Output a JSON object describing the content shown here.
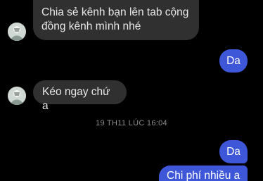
{
  "messages": [
    {
      "id": "m1",
      "direction": "incoming",
      "text_line1": "Chia sẻ kênh bạn lên tab cộng",
      "text_line2": "đồng kênh mình nhé"
    },
    {
      "id": "m2",
      "direction": "outgoing",
      "text": "Da"
    },
    {
      "id": "m3",
      "direction": "incoming",
      "text": "Kéo ngay chứ a"
    },
    {
      "id": "m4",
      "direction": "outgoing",
      "text": "Da"
    },
    {
      "id": "m5",
      "direction": "outgoing",
      "text": "Chi phí nhiều a"
    }
  ],
  "divider": {
    "timestamp": "19 TH11 LÚC 16:04"
  },
  "colors": {
    "background": "#000000",
    "incoming_bubble": "#303030",
    "outgoing_bubble": "#3e57d8",
    "timestamp_text": "#8c8c8c"
  },
  "icons": {
    "avatar": "contact-avatar"
  }
}
